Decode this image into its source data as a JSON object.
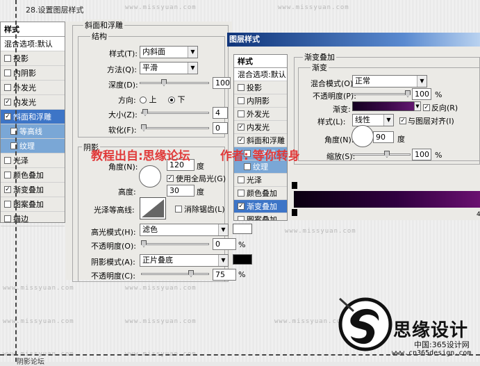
{
  "tutorial": {
    "title": "28.设置图层样式"
  },
  "watermark": "www.missyuan.com",
  "left_panel": {
    "header": "样式",
    "blend": "混合选项:默认",
    "items": [
      {
        "label": "投影",
        "checked": false
      },
      {
        "label": "内阴影",
        "checked": false
      },
      {
        "label": "外发光",
        "checked": false
      },
      {
        "label": "内发光",
        "checked": true
      },
      {
        "label": "斜面和浮雕",
        "checked": true,
        "selected": true
      },
      {
        "label": "等高线",
        "checked": false,
        "sub": true
      },
      {
        "label": "纹理",
        "checked": false,
        "sub": true
      },
      {
        "label": "光泽",
        "checked": false
      },
      {
        "label": "颜色叠加",
        "checked": false
      },
      {
        "label": "渐变叠加",
        "checked": true
      },
      {
        "label": "图案叠加",
        "checked": false
      },
      {
        "label": "描边",
        "checked": false
      }
    ]
  },
  "bevel": {
    "section": "斜面和浮雕",
    "structure": "结构",
    "style_label": "样式(T):",
    "style_value": "内斜面",
    "method_label": "方法(Q):",
    "method_value": "平滑",
    "depth_label": "深度(D):",
    "depth_value": "100",
    "direction_label": "方向:",
    "dir_up": "上",
    "dir_down": "下",
    "size_label": "大小(Z):",
    "size_value": "4",
    "soften_label": "软化(F):",
    "soften_value": "0",
    "shading": "阴影",
    "angle_label": "角度(N):",
    "angle_value": "120",
    "angle_unit": "度",
    "global_light": "使用全局光(G)",
    "altitude_label": "高度:",
    "altitude_value": "30",
    "altitude_unit": "度",
    "gloss_label": "光泽等高线:",
    "antialias": "消除锯齿(L)",
    "highlight_label": "高光模式(H):",
    "highlight_value": "滤色",
    "opacity1_label": "不透明度(O):",
    "opacity1_value": "0",
    "shadow_label": "阴影模式(A):",
    "shadow_value": "正片叠底",
    "opacity2_label": "不透明度(C):",
    "opacity2_value": "75",
    "percent": "%"
  },
  "dialog": {
    "title": "图层样式",
    "header": "样式",
    "blend": "混合选项:默认",
    "items": [
      {
        "label": "投影",
        "checked": false
      },
      {
        "label": "内阴影",
        "checked": false
      },
      {
        "label": "外发光",
        "checked": false
      },
      {
        "label": "内发光",
        "checked": true
      },
      {
        "label": "斜面和浮雕",
        "checked": true
      },
      {
        "label": "等高线",
        "checked": false,
        "sub": true
      },
      {
        "label": "纹理",
        "checked": false,
        "sub": true
      },
      {
        "label": "光泽",
        "checked": false
      },
      {
        "label": "颜色叠加",
        "checked": false
      },
      {
        "label": "渐变叠加",
        "checked": true,
        "selected": true
      },
      {
        "label": "图案叠加",
        "checked": false
      },
      {
        "label": "描边",
        "checked": false
      }
    ]
  },
  "gradient": {
    "section": "渐变叠加",
    "sub": "渐变",
    "blend_label": "混合模式(O):",
    "blend_value": "正常",
    "opacity_label": "不透明度(P):",
    "opacity_value": "100",
    "gradient_label": "渐变:",
    "reverse": "反向(R)",
    "style_label": "样式(L):",
    "style_value": "线性",
    "align": "与图层对齐(I)",
    "angle_label": "角度(N):",
    "angle_value": "90",
    "angle_unit": "度",
    "scale_label": "缩放(S):",
    "scale_value": "100",
    "percent": "%",
    "edge_value": "4"
  },
  "overlay_text": {
    "source": "教程出自:思缘论坛",
    "author": "作者: 等你转身"
  },
  "logo": {
    "brand": "思缘设计",
    "site1": "中国:365设计网",
    "site2": "www.cn365design.com"
  },
  "footer": {
    "partial": "阴影论坛"
  },
  "colors": {
    "selection": "#3d75c7",
    "gradient_start": "#1a0020",
    "gradient_end": "#5a1060",
    "watermark_red": "#e03a3a"
  }
}
